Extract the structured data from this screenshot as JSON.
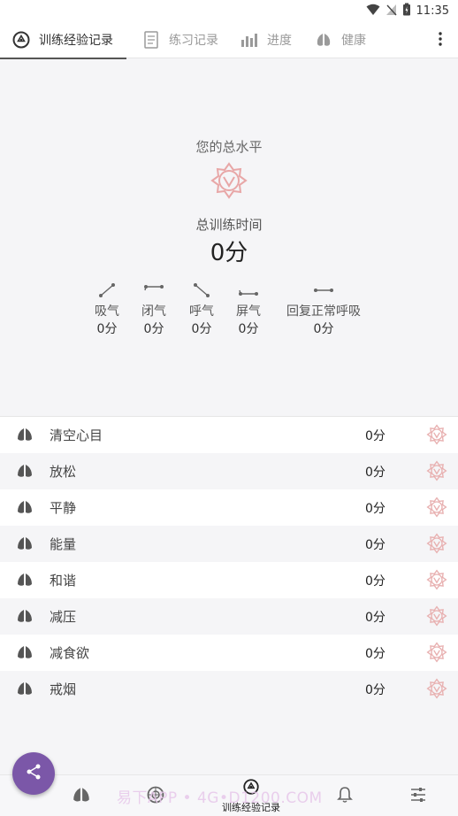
{
  "status": {
    "time": "11:35"
  },
  "tabs": [
    {
      "label": "训练经验记录"
    },
    {
      "label": "练习记录"
    },
    {
      "label": "进度"
    },
    {
      "label": "健康"
    }
  ],
  "summary": {
    "level_label": "您的总水平",
    "total_time_label": "总训练时间",
    "total_time_value": "0分",
    "phases": [
      {
        "name": "吸气",
        "value": "0分"
      },
      {
        "name": "闭气",
        "value": "0分"
      },
      {
        "name": "呼气",
        "value": "0分"
      },
      {
        "name": "屏气",
        "value": "0分"
      },
      {
        "name": "回复正常呼吸",
        "value": "0分"
      }
    ]
  },
  "exercises": [
    {
      "name": "清空心目",
      "value": "0分"
    },
    {
      "name": "放松",
      "value": "0分"
    },
    {
      "name": "平静",
      "value": "0分"
    },
    {
      "name": "能量",
      "value": "0分"
    },
    {
      "name": "和谐",
      "value": "0分"
    },
    {
      "name": "减压",
      "value": "0分"
    },
    {
      "name": "减食欲",
      "value": "0分"
    },
    {
      "name": "戒烟",
      "value": "0分"
    }
  ],
  "bottom_nav": {
    "active_label": "训练经验记录"
  },
  "watermark": "易下APP • 4G•D1200.COM",
  "colors": {
    "accent": "#7b57a8",
    "badge": "#e8a7a7",
    "icon_gray": "#9a9a9a"
  }
}
